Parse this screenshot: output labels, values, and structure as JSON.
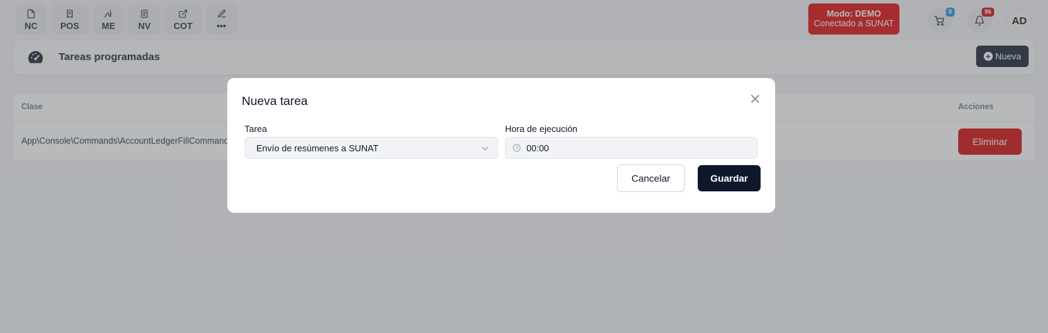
{
  "toolbar": {
    "quick_actions": [
      {
        "label": "NC",
        "icon": "document-icon"
      },
      {
        "label": "POS",
        "icon": "receipt-icon"
      },
      {
        "label": "ME",
        "icon": "signature-icon"
      },
      {
        "label": "NV",
        "icon": "note-icon"
      },
      {
        "label": "COT",
        "icon": "external-link-icon"
      },
      {
        "label": "•••",
        "icon": "edit-icon"
      }
    ],
    "demo_badge": {
      "line1": "Modo: DEMO",
      "line2": "Conectado a SUNAT",
      "color": "#e00000"
    },
    "cart_count": "0",
    "notification_count": "96",
    "avatar_initials": "AD"
  },
  "header": {
    "title": "Tareas programadas",
    "new_button": "Nueva"
  },
  "table": {
    "columns": {
      "class": "Clase",
      "actions": "Acciones"
    },
    "rows": [
      {
        "class": "App\\Console\\Commands\\AccountLedgerFillCommand",
        "action": "Eliminar"
      }
    ]
  },
  "modal": {
    "title": "Nueva tarea",
    "task_label": "Tarea",
    "task_value": "Envío de resúmenes a SUNAT",
    "time_label": "Hora de ejecución",
    "time_value": "00:00",
    "cancel": "Cancelar",
    "save": "Guardar"
  },
  "colors": {
    "primary_dark": "#0f172a",
    "danger": "#d40000",
    "badge_blue": "#1d8fe0",
    "badge_red": "#d10000"
  }
}
